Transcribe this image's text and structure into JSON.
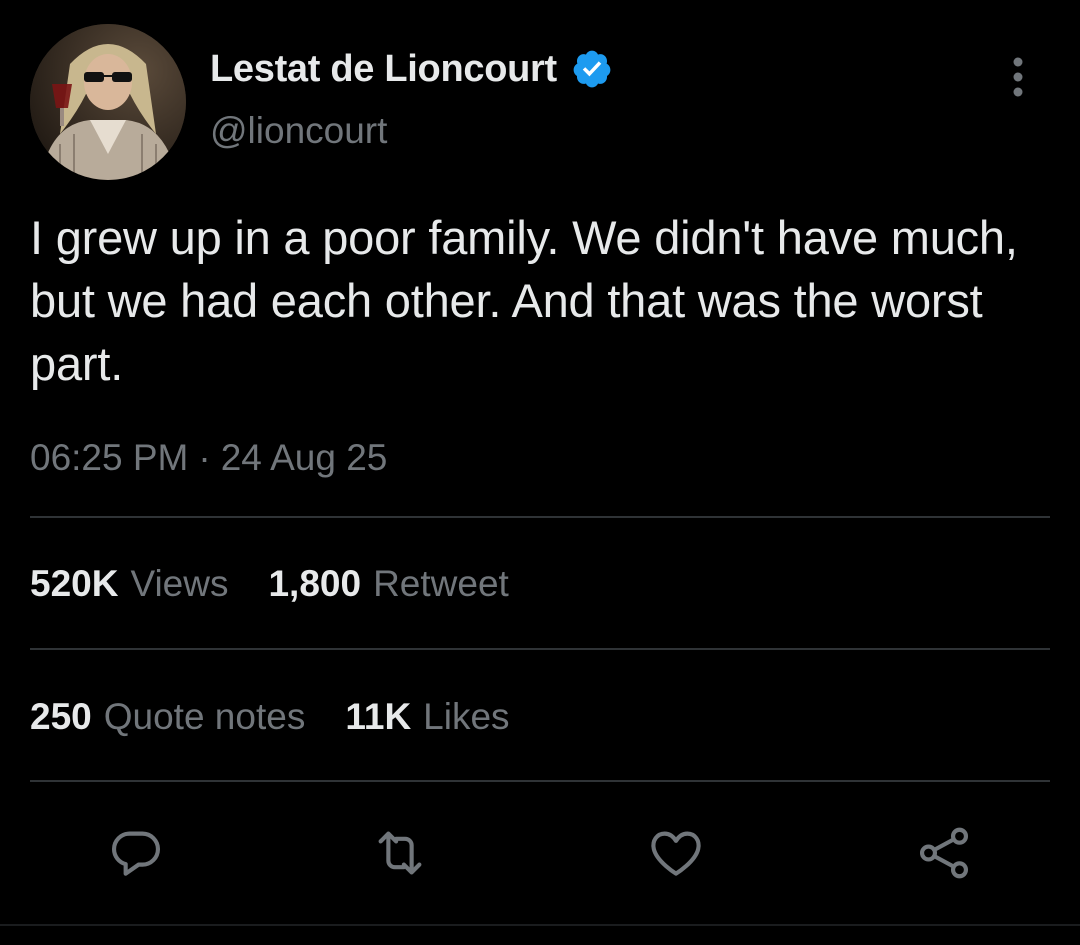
{
  "author": {
    "display_name": "Lestat de Lioncourt",
    "handle": "@lioncourt",
    "verified": true,
    "verified_color": "#1d9bf0"
  },
  "tweet": {
    "text": "I grew up in a poor family. We didn't have much, but we had each other. And that was the worst part.",
    "time": "06:25 PM",
    "separator": "·",
    "date": "24 Aug 25"
  },
  "stats": {
    "views": {
      "value": "520K",
      "label": "Views"
    },
    "retweets": {
      "value": "1,800",
      "label": "Retweet"
    },
    "quotes": {
      "value": "250",
      "label": "Quote notes"
    },
    "likes": {
      "value": "11K",
      "label": "Likes"
    }
  },
  "actions": [
    {
      "icon": "reply-icon"
    },
    {
      "icon": "retweet-icon"
    },
    {
      "icon": "like-icon"
    },
    {
      "icon": "share-icon"
    }
  ],
  "colors": {
    "background": "#000000",
    "text": "#e7e9ea",
    "secondary": "#71767b",
    "divider": "#2f3336"
  }
}
